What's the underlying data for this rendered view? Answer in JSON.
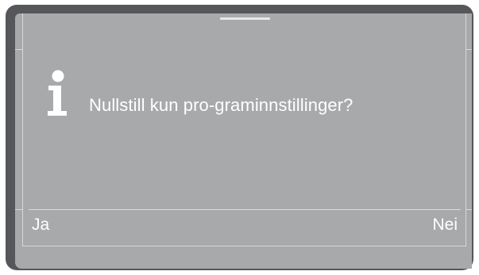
{
  "dialog": {
    "icon": "info-icon",
    "message": "Nullstill kun pro-graminnstillinger?",
    "yes_label": "Ja",
    "no_label": "Nei"
  },
  "colors": {
    "bezel": "#56575a",
    "screen": "#a8a9ab",
    "text": "#ffffff"
  }
}
